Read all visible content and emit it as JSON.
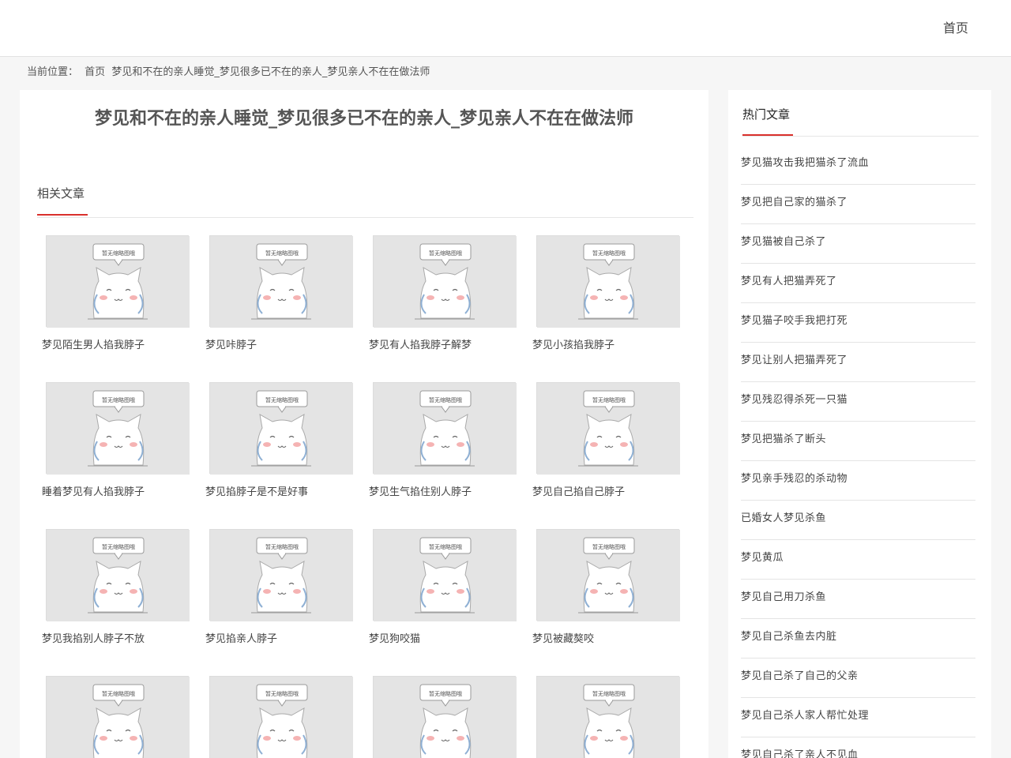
{
  "header": {
    "nav_home": "首页"
  },
  "breadcrumb": {
    "label": "当前位置：",
    "home": "首页",
    "current": "梦见和不在的亲人睡觉_梦见很多已不在的亲人_梦见亲人不在在做法师"
  },
  "article": {
    "title": "梦见和不在的亲人睡觉_梦见很多已不在的亲人_梦见亲人不在在做法师"
  },
  "related": {
    "heading": "相关文章",
    "thumbnail_caption": "暂无缩略图哦",
    "items": [
      {
        "title": "梦见陌生男人掐我脖子"
      },
      {
        "title": "梦见咔脖子"
      },
      {
        "title": "梦见有人掐我脖子解梦"
      },
      {
        "title": "梦见小孩掐我脖子"
      },
      {
        "title": "睡着梦见有人掐我脖子"
      },
      {
        "title": "梦见掐脖子是不是好事"
      },
      {
        "title": "梦见生气掐住别人脖子"
      },
      {
        "title": "梦见自己掐自己脖子"
      },
      {
        "title": "梦见我掐别人脖子不放"
      },
      {
        "title": "梦见掐亲人脖子"
      },
      {
        "title": "梦见狗咬猫"
      },
      {
        "title": "梦见被藏獒咬"
      },
      {
        "title": ""
      },
      {
        "title": ""
      },
      {
        "title": ""
      },
      {
        "title": ""
      }
    ]
  },
  "sidebar": {
    "heading": "热门文章",
    "items": [
      "梦见猫攻击我把猫杀了流血",
      "梦见把自己家的猫杀了",
      "梦见猫被自己杀了",
      "梦见有人把猫弄死了",
      "梦见猫子咬手我把打死",
      "梦见让别人把猫弄死了",
      "梦见残忍得杀死一只猫",
      "梦见把猫杀了断头",
      "梦见亲手残忍的杀动物",
      "已婚女人梦见杀鱼",
      "梦见黄瓜",
      "梦见自己用刀杀鱼",
      "梦见自己杀鱼去内脏",
      "梦见自己杀了自己的父亲",
      "梦见自己杀人家人帮忙处理",
      "梦见自己杀了亲人不见血"
    ]
  },
  "colors": {
    "accent": "#d9302c",
    "thumb_bg": "#e4e4e4"
  }
}
